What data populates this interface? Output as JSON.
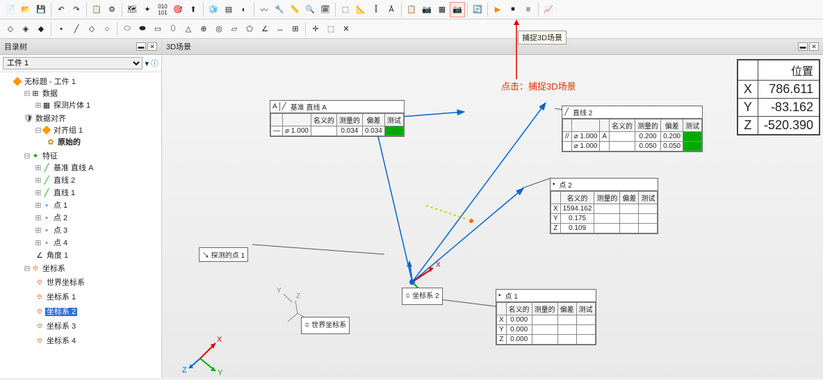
{
  "sidebar": {
    "title": "目录树",
    "combo_selected": "工件 1",
    "root": "无标题 - 工件 1",
    "nodes": {
      "data": "数据",
      "probe_body": "探测片体 1",
      "align": "数据对齐",
      "align_group": "对齐组 1",
      "original": "原始的",
      "features": "特征",
      "datum_a": "基准 直线 A",
      "line2": "直线 2",
      "line1": "直线 1",
      "pt1": "点 1",
      "pt2": "点 2",
      "pt3": "点 3",
      "pt4": "点 4",
      "angle1": "角度 1",
      "coord": "坐标系",
      "world": "世界坐标系",
      "cs1": "坐标系 1",
      "cs2": "坐标系 2",
      "cs3": "坐标系 3",
      "cs4": "坐标系 4"
    }
  },
  "viewport": {
    "title": "3D场景",
    "tooltip": "捕捉3D场景",
    "annotation": "点击：捕捉3D场景",
    "callouts": {
      "datum_line_a": {
        "title": "基准 直线 A",
        "hdr": [
          "名义的",
          "测量的",
          "偏差",
          "测试"
        ],
        "row": [
          "⌀ 1.000",
          "",
          "0.034",
          "0.034",
          ""
        ]
      },
      "line2": {
        "title": "直线 2",
        "hdr": [
          "名义的",
          "测量的",
          "偏差",
          "测试"
        ],
        "rows": [
          [
            "//",
            "⌀ 1.000",
            "A",
            "",
            "0.200",
            "0.200",
            ""
          ],
          [
            "",
            "⌀ 1.000",
            "",
            "",
            "0.050",
            "0.050",
            ""
          ]
        ]
      },
      "probed_pt1": "探测的点 1",
      "world_cs": "世界坐标系",
      "cs2": "坐标系 2",
      "pt2": {
        "title": "点 2",
        "hdr": [
          "",
          "名义的",
          "测量的",
          "偏差",
          "测试"
        ],
        "rows": [
          [
            "X",
            "1594.162",
            "",
            "",
            ""
          ],
          [
            "Y",
            "0.175",
            "",
            "",
            ""
          ],
          [
            "Z",
            "0.109",
            "",
            "",
            ""
          ]
        ]
      },
      "pt1": {
        "title": "点 1",
        "hdr": [
          "",
          "名义的",
          "测量的",
          "偏差",
          "测试"
        ],
        "rows": [
          [
            "X",
            "0.000",
            "",
            "",
            ""
          ],
          [
            "Y",
            "0.000",
            "",
            "",
            ""
          ],
          [
            "Z",
            "0.000",
            "",
            "",
            ""
          ]
        ]
      }
    }
  },
  "position": {
    "title": "位置",
    "x": "786.611",
    "y": "-83.162",
    "z": "-520.390"
  }
}
